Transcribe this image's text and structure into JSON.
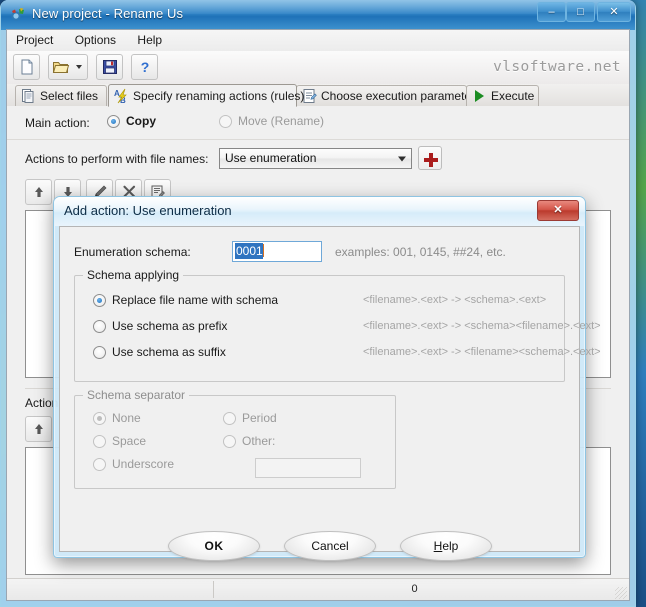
{
  "window": {
    "title": "New project - Rename Us",
    "icon": "app-icon",
    "buttons": {
      "minimize": "–",
      "maximize": "□",
      "close": "✕"
    }
  },
  "menu": {
    "items": [
      "Project",
      "Options",
      "Help"
    ]
  },
  "toolbar": {
    "buttons": [
      {
        "name": "new-project-button",
        "icon": "new-document-icon"
      },
      {
        "name": "open-project-button",
        "icon": "open-folder-icon",
        "has_dropdown": true
      },
      {
        "name": "save-project-button",
        "icon": "save-floppy-icon"
      },
      {
        "name": "help-button",
        "icon": "question-mark-icon"
      }
    ],
    "brand": "vlsoftware.net"
  },
  "tabs": [
    {
      "label": "Select files",
      "icon": "files-icon",
      "active": false
    },
    {
      "label": "Specify renaming actions (rules)",
      "icon": "ab-rename-icon",
      "active": true
    },
    {
      "label": "Choose execution parameters",
      "icon": "parameters-icon",
      "active": false
    },
    {
      "label": "Execute",
      "icon": "play-triangle-icon",
      "active": false
    }
  ],
  "page": {
    "main_action_label": "Main action:",
    "main_action_options": [
      {
        "label": "Copy",
        "selected": true,
        "disabled": false
      },
      {
        "label": "Move (Rename)",
        "selected": false,
        "disabled": true
      }
    ],
    "actions_label": "Actions to perform with file names:",
    "action_combo_value": "Use enumeration",
    "add_action_button": "+",
    "rules_toolbar": [
      {
        "name": "move-up-button",
        "icon": "arrow-up-icon"
      },
      {
        "name": "move-down-button",
        "icon": "arrow-down-icon"
      },
      {
        "name": "edit-rule-button",
        "icon": "pencil-icon"
      },
      {
        "name": "delete-rule-button",
        "icon": "x-cross-icon"
      },
      {
        "name": "edit-list-button",
        "icon": "list-edit-icon"
      }
    ],
    "lower_label": "Actions",
    "lower_toolbar": [
      {
        "name": "move-up-button",
        "icon": "arrow-up-icon"
      }
    ]
  },
  "statusbar": {
    "left": "",
    "right": "0"
  },
  "dialog": {
    "title": "Add action: Use enumeration",
    "close_button": "✕",
    "enumeration_label": "Enumeration schema:",
    "enumeration_value": "0001",
    "enumeration_examples": "examples: 001, 0145, ##24, etc.",
    "schema_applying": {
      "legend": "Schema applying",
      "options": [
        {
          "label": "Replace file name with schema",
          "hint": "<filename>.<ext>  ->  <schema>.<ext>",
          "selected": true
        },
        {
          "label": "Use schema as prefix",
          "hint": "<filename>.<ext>  ->  <schema><filename>.<ext>",
          "selected": false
        },
        {
          "label": "Use schema as suffix",
          "hint": "<filename>.<ext>  ->  <filename><schema>.<ext>",
          "selected": false
        }
      ]
    },
    "schema_separator": {
      "legend": "Schema separator",
      "disabled": true,
      "options_left": [
        {
          "label": "None",
          "selected": true
        },
        {
          "label": "Space",
          "selected": false
        },
        {
          "label": "Underscore",
          "selected": false
        }
      ],
      "options_right": [
        {
          "label": "Period",
          "selected": false
        },
        {
          "label": "Other:",
          "selected": false
        }
      ],
      "other_value": ""
    },
    "buttons": {
      "ok": "OK",
      "cancel": "Cancel",
      "help_prefix": "H",
      "help_rest": "elp"
    }
  },
  "colors": {
    "accent": "#2f83c6",
    "close_red": "#bb3a2d",
    "plus_red": "#aa1c1c",
    "selection_blue": "#2f74c0"
  }
}
